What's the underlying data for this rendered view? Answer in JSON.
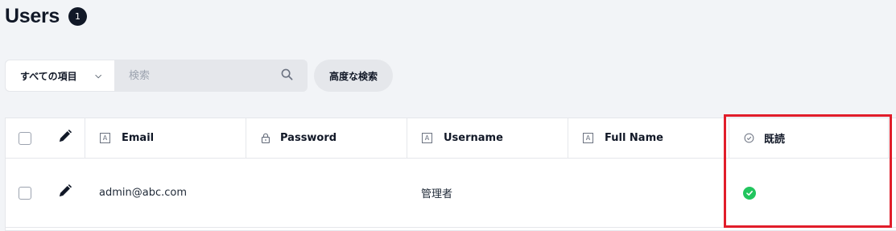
{
  "page": {
    "title": "Users",
    "count": "1"
  },
  "toolbar": {
    "filter_label": "すべての項目",
    "search_placeholder": "検索",
    "advanced_search_label": "高度な検索"
  },
  "table": {
    "columns": [
      {
        "label": "Email",
        "icon": "text-field-icon"
      },
      {
        "label": "Password",
        "icon": "lock-icon"
      },
      {
        "label": "Username",
        "icon": "text-field-icon"
      },
      {
        "label": "Full Name",
        "icon": "text-field-icon"
      },
      {
        "label": "既読",
        "icon": "check-circle-outline-icon"
      }
    ],
    "rows": [
      {
        "email": "admin@abc.com",
        "password": "",
        "username": "管理者",
        "full_name": "",
        "read": true
      }
    ]
  },
  "colors": {
    "highlight": "#e11d2a",
    "read_check": "#22c55e",
    "badge": "#111827"
  }
}
